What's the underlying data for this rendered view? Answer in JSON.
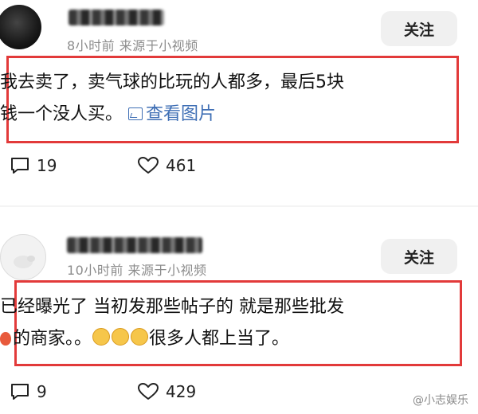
{
  "posts": [
    {
      "meta": "8小时前  来源于小视频",
      "follow_label": "关注",
      "content_line1": "我去卖了，卖气球的比玩的人都多，最后5块",
      "content_line2": "钱一个没人买。",
      "view_image_label": "查看图片",
      "comment_count": "19",
      "like_count": "461",
      "icons": [
        "comment-icon",
        "heart-icon",
        "image-icon"
      ]
    },
    {
      "meta": "10小时前  来源于小视频",
      "follow_label": "关注",
      "content_line1": "已经曝光了 当初发那些帖子的 就是那些批发",
      "content_line2a": "的商家。。",
      "content_line2b": "很多人都上当了。",
      "comment_count": "9",
      "like_count": "429",
      "icons": [
        "comment-icon",
        "heart-icon",
        "balloon-icon",
        "laughing-emoji-icon"
      ]
    }
  ],
  "watermark": "@小志娱乐",
  "colors": {
    "highlight": "#e23a3a",
    "link": "#3f6fb5",
    "meta": "#8c8c8c"
  }
}
